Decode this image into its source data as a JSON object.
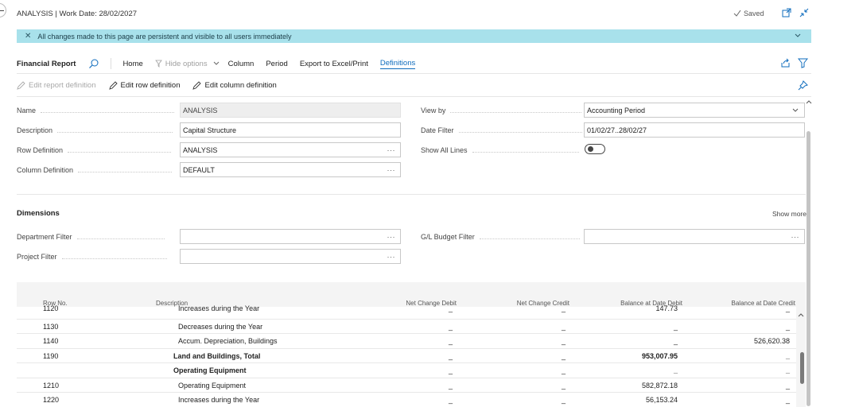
{
  "header": {
    "title": "ANALYSIS | Work Date: 28/02/2027",
    "saved_label": "Saved"
  },
  "banner": {
    "text": "All changes made to this page are persistent and visible to all users immediately"
  },
  "actionbar": {
    "title": "Financial Report",
    "items": [
      "Home",
      "Hide options",
      "Column",
      "Period",
      "Export to Excel/Print",
      "Definitions"
    ]
  },
  "subbar": {
    "items": [
      "Edit report definition",
      "Edit row definition",
      "Edit column definition"
    ]
  },
  "general": {
    "name_label": "Name",
    "name_value": "ANALYSIS",
    "description_label": "Description",
    "description_value": "Capital Structure",
    "row_def_label": "Row Definition",
    "row_def_value": "ANALYSIS",
    "col_def_label": "Column Definition",
    "col_def_value": "DEFAULT",
    "view_by_label": "View by",
    "view_by_value": "Accounting Period",
    "date_filter_label": "Date Filter",
    "date_filter_value": "01/02/27..28/02/27",
    "show_all_label": "Show All Lines"
  },
  "dimensions": {
    "title": "Dimensions",
    "show_more": "Show more",
    "department_label": "Department Filter",
    "project_label": "Project Filter",
    "budget_label": "G/L Budget Filter"
  },
  "grid": {
    "columns": [
      "Row No.",
      "Description",
      "Net Change Debit",
      "Net Change Credit",
      "Balance at Date Debit",
      "Balance at Date Credit"
    ],
    "rows": [
      {
        "no": "1120",
        "desc": "Increases during the Year",
        "ncd": "_",
        "ncc": "_",
        "bdd": "147.73",
        "bdc": "_",
        "bold": false
      },
      {
        "no": "1130",
        "desc": "Decreases during the Year",
        "ncd": "_",
        "ncc": "_",
        "bdd": "_",
        "bdc": "_",
        "bold": false
      },
      {
        "no": "1140",
        "desc": "Accum. Depreciation, Buildings",
        "ncd": "_",
        "ncc": "_",
        "bdd": "_",
        "bdc": "526,620.38",
        "bold": false
      },
      {
        "no": "1190",
        "desc": "Land and Buildings, Total",
        "ncd": "_",
        "ncc": "_",
        "bdd": "953,007.95",
        "bdc": "_",
        "bold": true
      },
      {
        "no": "",
        "desc": "Operating Equipment",
        "ncd": "_",
        "ncc": "_",
        "bdd": "_",
        "bdc": "_",
        "bold": true
      },
      {
        "no": "1210",
        "desc": "Operating Equipment",
        "ncd": "_",
        "ncc": "_",
        "bdd": "582,872.18",
        "bdc": "_",
        "bold": false
      },
      {
        "no": "1220",
        "desc": "Increases during the Year",
        "ncd": "_",
        "ncc": "_",
        "bdd": "56,153.24",
        "bdc": "_",
        "bold": false
      }
    ]
  },
  "colors": {
    "accent": "#0f6cbd",
    "banner_bg": "#a8e1eb"
  }
}
